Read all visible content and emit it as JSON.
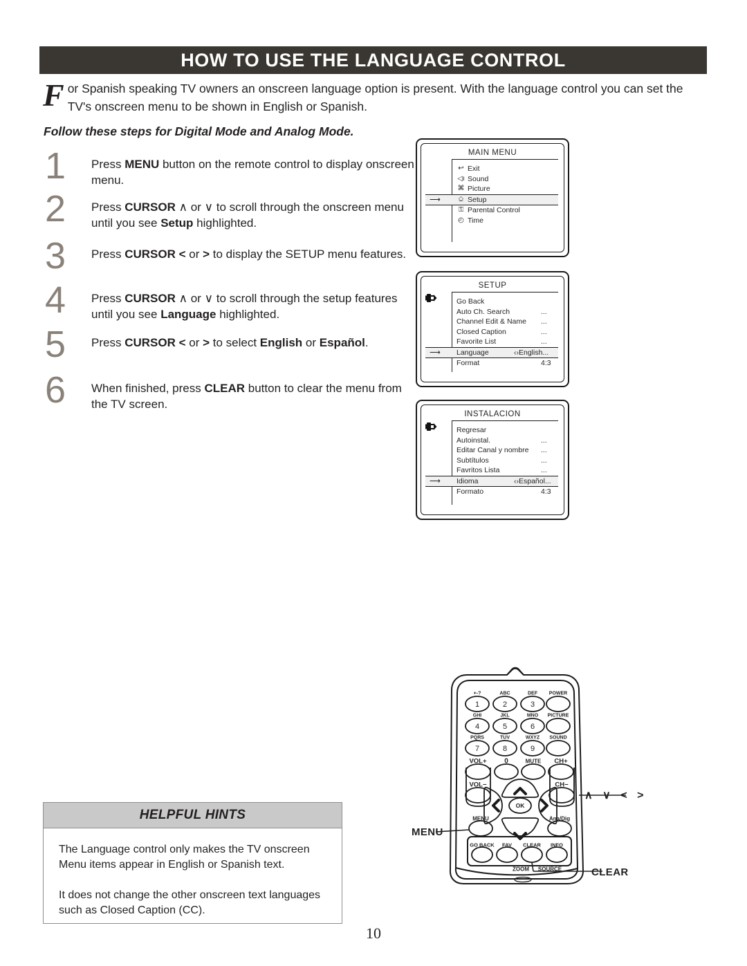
{
  "header": {
    "title": "HOW TO USE THE LANGUAGE CONTROL"
  },
  "intro": {
    "dropcap": "F",
    "text": "or Spanish speaking TV owners an onscreen language option is present. With the language control you can set the TV's onscreen menu to be shown in English or Spanish."
  },
  "subheading": "Follow these steps for Digital Mode and Analog Mode.",
  "steps": [
    {
      "number": "1",
      "html": "Press <b>MENU</b> button on the remote control to display onscreen menu."
    },
    {
      "number": "2",
      "html": "Press <b>CURSOR</b> ∧ or ∨ to scroll through the onscreen menu until you see <b>Setup</b> highlighted."
    },
    {
      "number": "3",
      "html": "Press <b>CURSOR</b> <b>&lt;</b> or <b>&gt;</b> to display the SETUP menu features."
    },
    {
      "number": "4",
      "html": "Press <b>CURSOR</b> ∧ or ∨ to scroll through the setup features until you see <b>Language</b> highlighted."
    },
    {
      "number": "5",
      "html": "Press <b>CURSOR</b> <b>&lt;</b> or <b>&gt;</b> to select <b>English</b> or <b>Español</b>."
    },
    {
      "number": "6",
      "html": "When finished, press <b>CLEAR</b> button to clear the menu from the TV screen."
    }
  ],
  "menus": {
    "main": {
      "title": "MAIN MENU",
      "rows": [
        {
          "icon": "exit-icon",
          "glyph": "↩",
          "label": "Exit",
          "value": "",
          "highlight": false
        },
        {
          "icon": "sound-icon",
          "glyph": "◁ı",
          "label": "Sound",
          "value": "",
          "highlight": false
        },
        {
          "icon": "picture-icon",
          "glyph": "⌘",
          "label": "Picture",
          "value": "",
          "highlight": false
        },
        {
          "icon": "setup-plug-icon",
          "glyph": "⎐",
          "label": "Setup",
          "value": "",
          "highlight": true
        },
        {
          "icon": "parental-control-icon",
          "glyph": "⚿",
          "label": "Parental Control",
          "value": "",
          "highlight": false
        },
        {
          "icon": "time-clock-icon",
          "glyph": "◴",
          "label": "Time",
          "value": "",
          "highlight": false
        }
      ]
    },
    "setup": {
      "title": "SETUP",
      "badge": "setup-plug-icon",
      "rows": [
        {
          "label": "Go Back",
          "value": "",
          "highlight": false
        },
        {
          "label": "Auto Ch. Search",
          "value": "...",
          "highlight": false
        },
        {
          "label": "Channel Edit & Name",
          "value": "...",
          "highlight": false
        },
        {
          "label": "Closed Caption",
          "value": "...",
          "highlight": false
        },
        {
          "label": "Favorite List",
          "value": "...",
          "highlight": false
        },
        {
          "label": "Language",
          "value": "‹›English...",
          "highlight": true
        },
        {
          "label": "Format",
          "value": "4:3",
          "highlight": false
        }
      ]
    },
    "instalacion": {
      "title": "INSTALACION",
      "badge": "setup-plug-icon",
      "rows": [
        {
          "label": "Regresar",
          "value": "",
          "highlight": false
        },
        {
          "label": "Autoinstal.",
          "value": "...",
          "highlight": false
        },
        {
          "label": "Editar Canal y nombre",
          "value": "...",
          "highlight": false
        },
        {
          "label": "Subtítulos",
          "value": "...",
          "highlight": false
        },
        {
          "label": "Favritos Lista",
          "value": "...",
          "highlight": false
        },
        {
          "label": "Idioma",
          "value": "‹›Español...",
          "highlight": true
        },
        {
          "label": "Formato",
          "value": "4:3",
          "highlight": false
        }
      ]
    }
  },
  "remote": {
    "keys": [
      {
        "sub": "+-?",
        "label": "1"
      },
      {
        "sub": "ABC",
        "label": "2"
      },
      {
        "sub": "DEF",
        "label": "3"
      },
      {
        "sub": "POWER",
        "label": ""
      },
      {
        "sub": "GHI",
        "label": "4"
      },
      {
        "sub": "JKL",
        "label": "5"
      },
      {
        "sub": "MNO",
        "label": "6"
      },
      {
        "sub": "PICTURE",
        "label": ""
      },
      {
        "sub": "PQRS",
        "label": "7"
      },
      {
        "sub": "TUV",
        "label": "8"
      },
      {
        "sub": "WXYZ",
        "label": "9"
      },
      {
        "sub": "SOUND",
        "label": ""
      }
    ],
    "vol_up": "VOL+",
    "vol_down": "VOL−",
    "zero": "0",
    "mute": "MUTE",
    "ch_up": "CH+",
    "ch_down": "CH−",
    "ok": "OK",
    "menu": "MENU",
    "anadig": "Ana/Dig",
    "bottom_keys": [
      "GO BACK",
      "FAV",
      "CLEAR",
      "INFO"
    ],
    "bottom_labels": [
      "ZOOM",
      "SOURCE"
    ],
    "callouts": {
      "menu": "MENU",
      "clear": "CLEAR",
      "cursor": "∧ ∨ < >"
    }
  },
  "hints": {
    "title": "HELPFUL HINTS",
    "paragraphs": [
      "The Language control only makes the TV onscreen Menu items appear in English or Spanish text.",
      "It does not change the other onscreen text languages such as Closed Caption (CC)."
    ]
  },
  "page_number": "10"
}
